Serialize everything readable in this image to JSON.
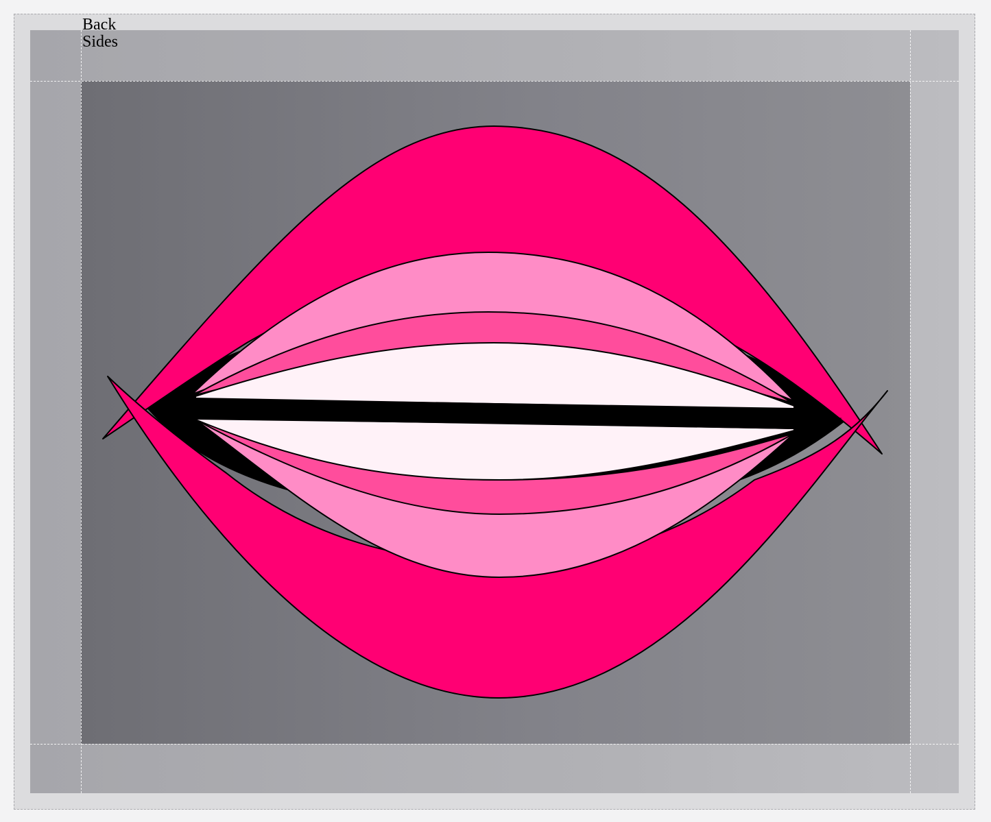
{
  "labels": {
    "back": "Back",
    "sides": "Sides"
  },
  "colors": {
    "page_background": "#f3f3f4",
    "outer_frame": "#dcdcde",
    "sides_panel": "#b1b1b5",
    "back_panel": "#7c7c82",
    "lip_outer": "#ff0073",
    "lip_light": "#ff8cc6",
    "lip_mid": "#ff4d9c",
    "teeth": "#fff2f8",
    "mouth_line": "#000000",
    "guide_lines": "#ffffff"
  },
  "icons": {
    "artwork": "lips-illustration"
  }
}
